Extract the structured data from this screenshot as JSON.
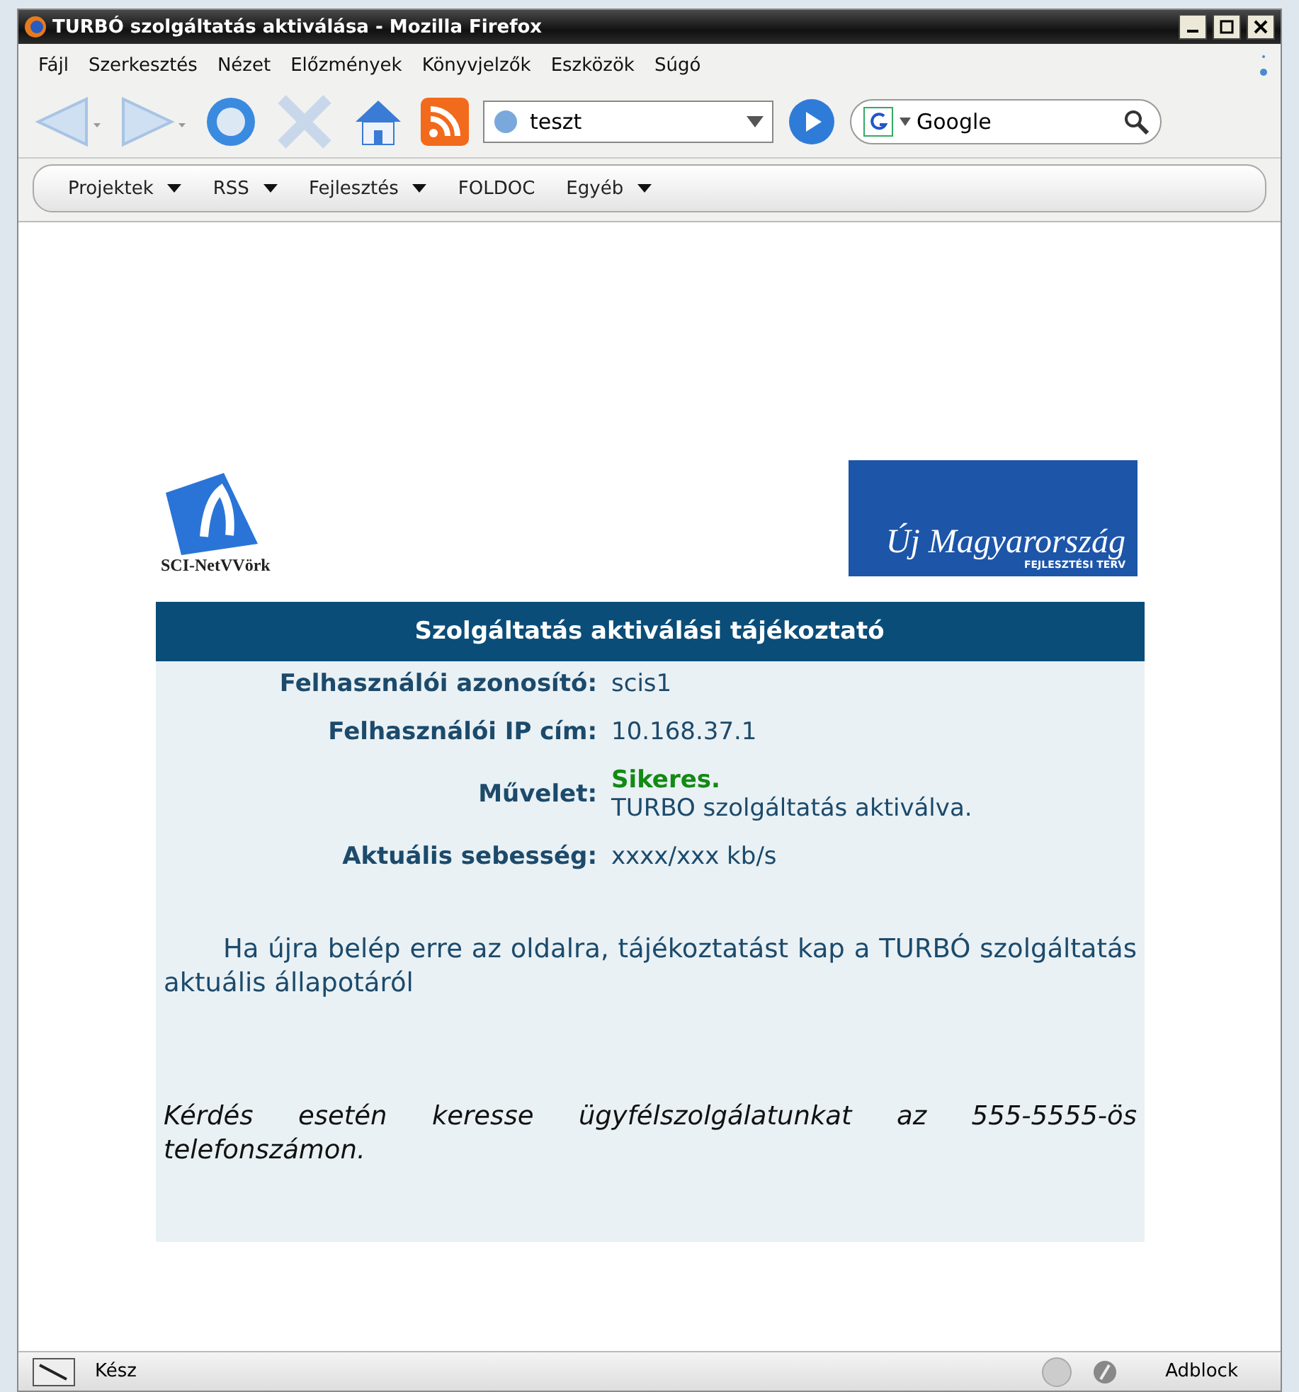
{
  "window": {
    "title": "TURBÓ szolgáltatás aktiválása - Mozilla Firefox"
  },
  "menu": [
    "Fájl",
    "Szerkesztés",
    "Nézet",
    "Előzmények",
    "Könyvjelzők",
    "Eszközök",
    "Súgó"
  ],
  "address": {
    "value": "teszt"
  },
  "search": {
    "engine": "Google"
  },
  "bookmarks": [
    {
      "label": "Projektek",
      "dropdown": true
    },
    {
      "label": "RSS",
      "dropdown": true
    },
    {
      "label": "Fejlesztés",
      "dropdown": true
    },
    {
      "label": "FOLDOC",
      "dropdown": false
    },
    {
      "label": "Egyéb",
      "dropdown": true
    }
  ],
  "logos": {
    "left": "SCI-NetVVörk",
    "right_title": "Új Magyarország",
    "right_subtitle": "FEJLESZTÉSI TERV"
  },
  "panel": {
    "title": "Szolgáltatás aktiválási tájékoztató",
    "fields": [
      {
        "label": "Felhasználói azonosító:",
        "values": [
          "scis1"
        ]
      },
      {
        "label": "Felhasználói IP cím:",
        "values": [
          "10.168.37.1"
        ]
      },
      {
        "label": "Művelet:",
        "status": "Sikeres.",
        "values": [
          "TURBO szolgáltatás aktiválva."
        ]
      },
      {
        "label": "Aktuális sebesség:",
        "values": [
          "xxxx/xxx kb/s"
        ]
      }
    ],
    "info": "Ha újra belép erre az oldalra, tájékoztatást kap a TURBÓ szolgáltatás aktuális állapotáról",
    "contact": "Kérdés esetén keresse ügyfélszolgálatunkat az 555-5555-ös telefonszámon."
  },
  "status_bar": {
    "text": "Kész",
    "addon": "Adblock"
  }
}
